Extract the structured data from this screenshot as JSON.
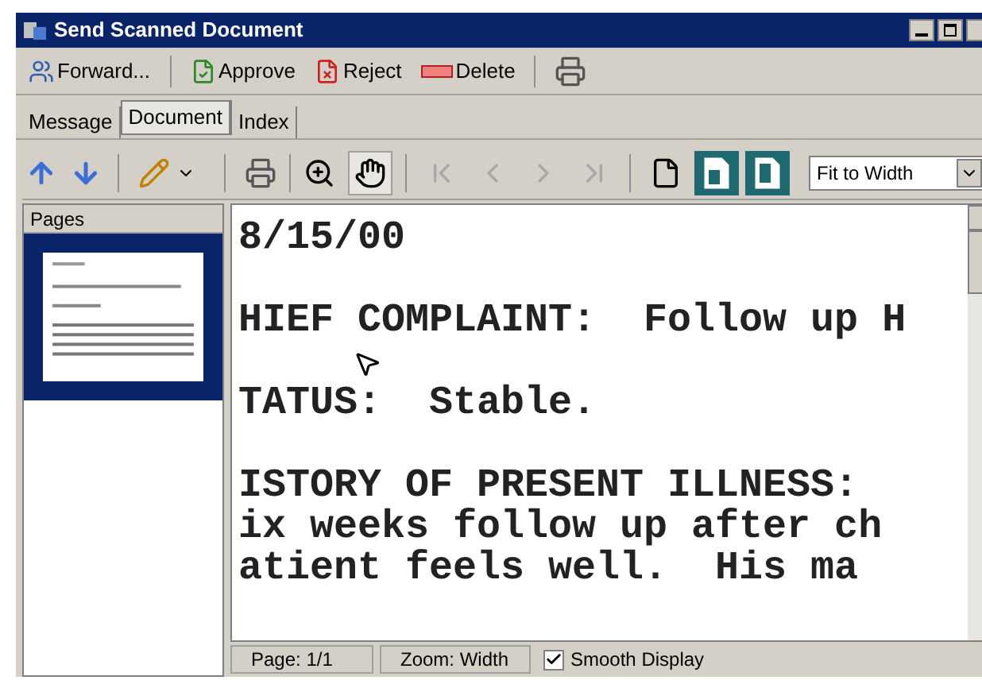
{
  "window": {
    "title": "Send Scanned Document"
  },
  "toolbar": [
    {
      "kind": "forward",
      "label": "Forward..."
    },
    {
      "kind": "approve",
      "label": "Approve"
    },
    {
      "kind": "reject",
      "label": "Reject"
    },
    {
      "kind": "delete",
      "label": "Delete"
    },
    {
      "kind": "print"
    }
  ],
  "tabs": [
    {
      "label": "Message",
      "selected": false
    },
    {
      "label": "Document",
      "selected": true
    },
    {
      "label": "Index",
      "selected": false
    }
  ],
  "viewer_toolbar": {
    "nav_buttons": [
      {
        "kind": "first",
        "disabled": true
      },
      {
        "kind": "prev",
        "disabled": true
      },
      {
        "kind": "next",
        "disabled": true
      },
      {
        "kind": "last",
        "disabled": true
      }
    ],
    "view_buttons": [
      {
        "kind": "page",
        "selected": false
      },
      {
        "kind": "fit-page",
        "selected": true
      },
      {
        "kind": "fit-width",
        "selected": true
      }
    ],
    "zoom_select": {
      "value": "Fit to Width"
    }
  },
  "pages_panel": {
    "title": "Pages"
  },
  "document": {
    "paragraphs": [
      {
        "lines": [
          "8/15/00"
        ]
      },
      {
        "lines": [
          "HIEF COMPLAINT:  Follow up H"
        ]
      },
      {
        "lines": [
          "TATUS:  Stable."
        ]
      },
      {
        "lines": [
          "ISTORY OF PRESENT ILLNESS:",
          "ix weeks follow up after ch",
          "atient feels well.  His ma"
        ]
      }
    ]
  },
  "status_bar": {
    "page": "Page: 1/1",
    "zoom": "Zoom: Width",
    "smooth_display": {
      "label": "Smooth Display",
      "checked": true
    }
  }
}
